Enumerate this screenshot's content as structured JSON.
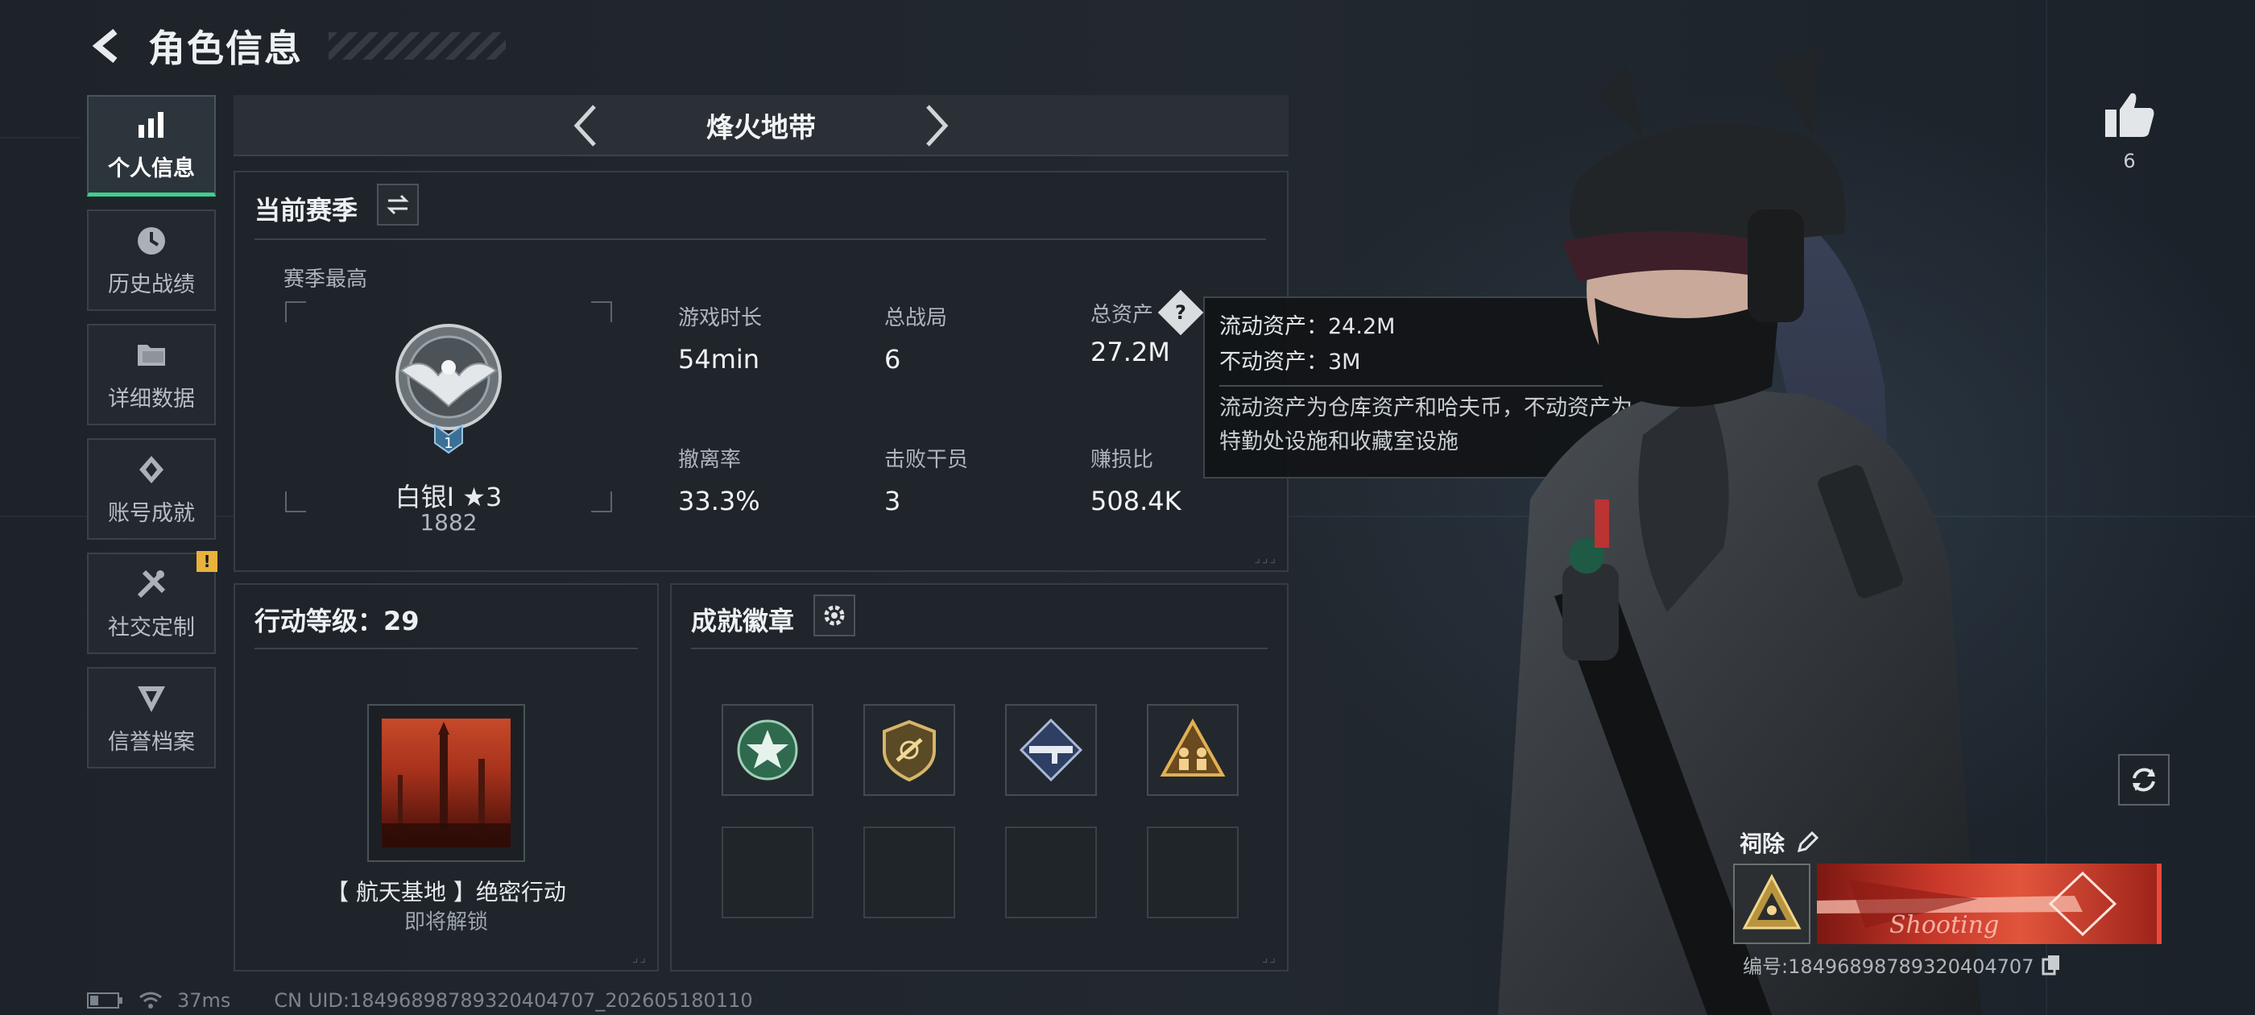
{
  "header": {
    "title": "角色信息"
  },
  "sidebar": {
    "items": [
      {
        "label": "个人信息",
        "icon": "bar-chart-icon",
        "active": true
      },
      {
        "label": "历史战绩",
        "icon": "history-icon"
      },
      {
        "label": "详细数据",
        "icon": "folder-icon"
      },
      {
        "label": "账号成就",
        "icon": "achievement-icon"
      },
      {
        "label": "社交定制",
        "icon": "tools-icon",
        "alert": "!"
      },
      {
        "label": "信誉档案",
        "icon": "credit-icon"
      }
    ]
  },
  "mode": {
    "title": "烽火地带"
  },
  "season": {
    "title": "当前赛季",
    "subtitle": "赛季最高",
    "rank_name": "白银I ★3",
    "rank_score": "1882",
    "rank_level": "1",
    "stats": [
      {
        "label": "游戏时长",
        "value": "54min"
      },
      {
        "label": "总战局",
        "value": "6"
      },
      {
        "label": "总资产",
        "value": "27.2M",
        "help": "?"
      },
      {
        "label": "撤离率",
        "value": "33.3%"
      },
      {
        "label": "击败干员",
        "value": "3"
      },
      {
        "label": "赚损比",
        "value": "508.4K"
      }
    ]
  },
  "tooltip": {
    "liquid": "流动资产：24.2M",
    "fixed": "不动资产：3M",
    "description": "流动资产为仓库资产和哈夫币，不动资产为特勤处设施和收藏室设施"
  },
  "action_level": {
    "title": "行动等级：29",
    "task_name": "【 航天基地 】绝密行动",
    "task_status": "即将解锁"
  },
  "badges": {
    "title": "成就徽章"
  },
  "player": {
    "likes": "6",
    "name": "祠除",
    "uid_line": "编号:18496898789320404707",
    "plate_text": "Shooting"
  },
  "footer": {
    "ping": "37ms",
    "uid": "CN UID:18496898789320404707_202605180110"
  },
  "colors": {
    "accent_green": "#3fcf8e",
    "alert_yellow": "#e8b23c",
    "plate_red": "#e2553c"
  }
}
